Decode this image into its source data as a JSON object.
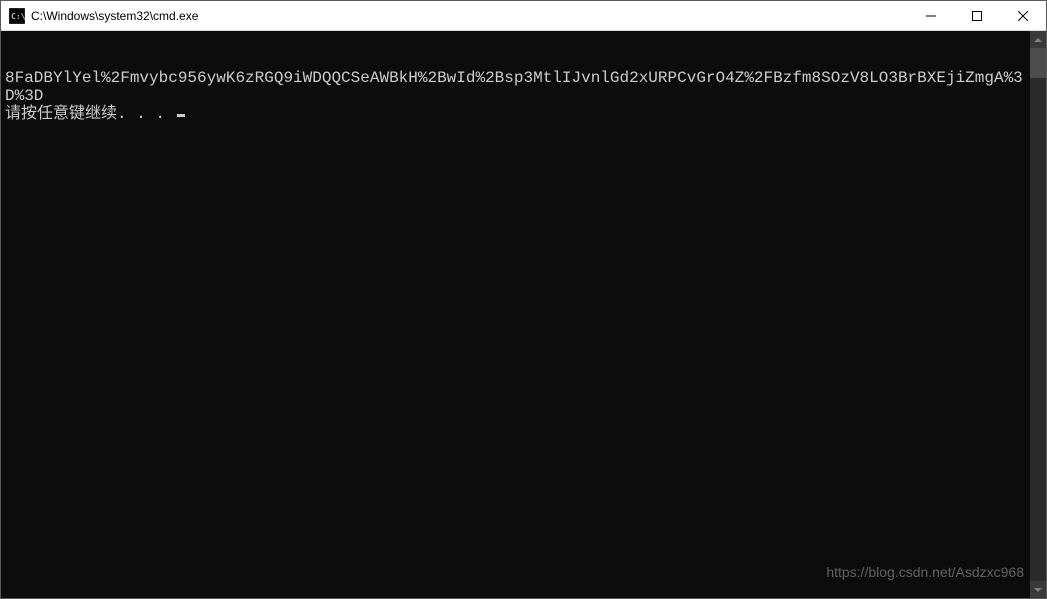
{
  "window": {
    "title": "C:\\Windows\\system32\\cmd.exe"
  },
  "console": {
    "line1": "8FaDBYlYel%2Fmvybc956ywK6zRGQ9iWDQQCSeAWBkH%2BwId%2Bsp3MtlIJvnlGd2xURPCvGrO4Z%2FBzfm8SOzV8LO3BrBXEjiZmgA%3D%3D",
    "prompt": "请按任意键继续. . . "
  },
  "watermark": "https://blog.csdn.net/Asdzxc968"
}
